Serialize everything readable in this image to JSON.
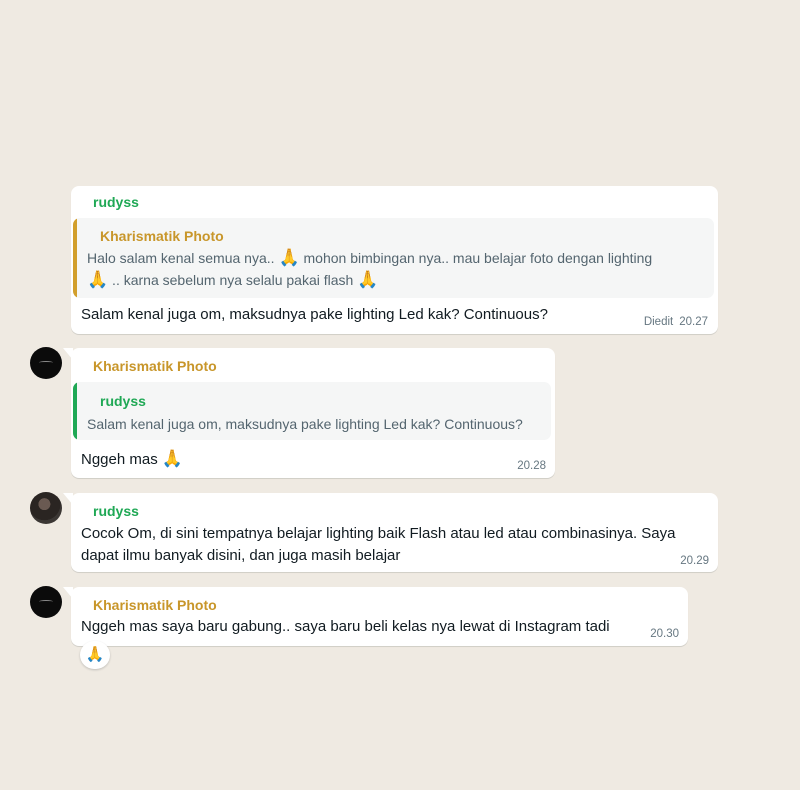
{
  "messages": [
    {
      "sender": "rudyss",
      "quote": {
        "name": "Kharismatik Photo",
        "line1a": "Halo salam kenal semua nya.. ",
        "line1b": " mohon bimbingan nya.. mau belajar foto  dengan lighting",
        "line2a": " .. karna sebelum nya selalu pakai flash ",
        "emoji": "🙏"
      },
      "text": "Salam kenal juga om, maksudnya pake lighting Led kak? Continuous?",
      "edited": "Diedit",
      "time": "20.27"
    },
    {
      "sender": "Kharismatik Photo",
      "quote": {
        "name": "rudyss",
        "text": "Salam kenal juga om, maksudnya pake lighting Led kak? Continuous?"
      },
      "text": "Nggeh mas ",
      "emoji": "🙏",
      "time": "20.28"
    },
    {
      "sender": "rudyss",
      "line1": "Cocok Om, di sini tempatnya belajar lighting baik Flash atau led atau combinasinya. Saya",
      "line2": "dapat ilmu banyak disini, dan juga masih belajar",
      "time": "20.29"
    },
    {
      "sender": "Kharismatik Photo",
      "text": "Nggeh mas saya baru gabung.. saya baru beli kelas nya lewat di Instagram tadi",
      "time": "20.30",
      "reaction": "🙏"
    }
  ],
  "colors": {
    "background": "#efeae2",
    "bubble": "#ffffff",
    "name_green": "#1fa855",
    "name_gold": "#c8962a",
    "meta": "#667781"
  }
}
